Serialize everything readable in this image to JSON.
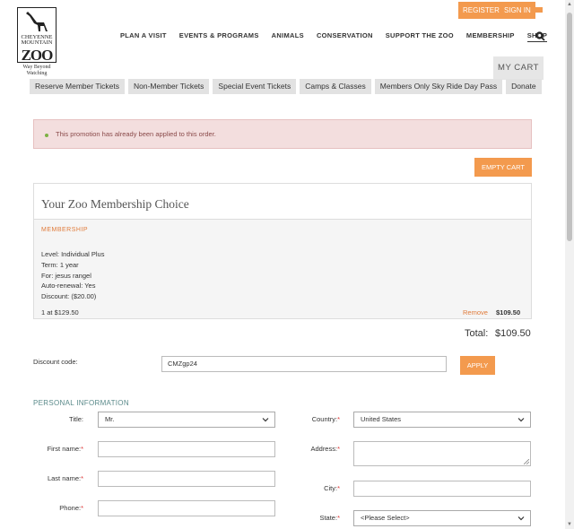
{
  "logo": {
    "line1": "CHEYENNE",
    "line2": "MOUNTAIN",
    "zoo": "ZOO",
    "tagline1": "Way Beyond",
    "tagline2": "Watching"
  },
  "header": {
    "register": "REGISTER",
    "signin": "SIGN IN",
    "nav": [
      "PLAN A VISIT",
      "EVENTS & PROGRAMS",
      "ANIMALS",
      "CONSERVATION",
      "SUPPORT THE ZOO",
      "MEMBERSHIP",
      "SHOP"
    ],
    "cart": "MY CART"
  },
  "tabs": [
    "Reserve Member Tickets",
    "Non-Member Tickets",
    "Special Event Tickets",
    "Camps & Classes",
    "Members Only Sky Ride Day Pass",
    "Donate"
  ],
  "alert": {
    "message": "This promotion has already been applied to this order."
  },
  "empty_cart": "EMPTY CART",
  "membership": {
    "title": "Your Zoo Membership Choice",
    "label": "MEMBERSHIP",
    "level": "Level: Individual Plus",
    "term": "Term: 1 year",
    "for": "For: jesus rangel",
    "autorenew": "Auto-renewal: Yes",
    "discount": "Discount: ($20.00)",
    "qty": "1 at $129.50",
    "remove": "Remove",
    "price": "$109.50"
  },
  "total": {
    "label": "Total:",
    "value": "$109.50"
  },
  "discount": {
    "label": "Discount code:",
    "value": "CMZgp24",
    "apply": "APPLY"
  },
  "personal": {
    "section": "PERSONAL INFORMATION",
    "title_label": "Title:",
    "title_value": "Mr.",
    "first_label": "First name:",
    "last_label": "Last name:",
    "phone_label": "Phone:",
    "country_label": "Country:",
    "country_value": "United States",
    "address_label": "Address:",
    "city_label": "City:",
    "state_label": "State:",
    "state_value": "<Please Select>",
    "required": "*"
  },
  "colors": {
    "accent": "#f39a4e",
    "alert_bg": "#f3dede",
    "section": "#5a8a8a"
  }
}
